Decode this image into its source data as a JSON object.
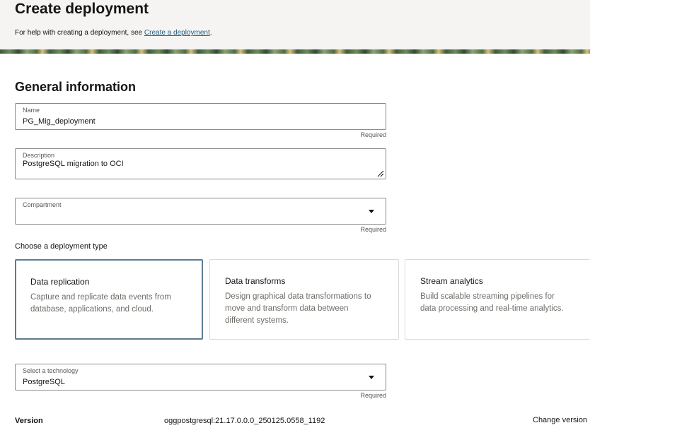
{
  "header": {
    "title": "Create deployment",
    "help_prefix": "For help with creating a deployment, see ",
    "help_link": "Create a deployment",
    "help_suffix": "."
  },
  "general": {
    "title": "General information",
    "name": {
      "label": "Name",
      "value": "PG_Mig_deployment",
      "required": "Required"
    },
    "description": {
      "label": "Description",
      "value": "PostgreSQL migration to OCI"
    },
    "compartment": {
      "label": "Compartment",
      "value": "",
      "required": "Required"
    }
  },
  "deployment_type": {
    "label": "Choose a deployment type",
    "cards": [
      {
        "title": "Data replication",
        "desc_lines": [
          "Capture and replicate data events from",
          "database, applications, and cloud."
        ],
        "selected": true
      },
      {
        "title": "Data transforms",
        "desc_lines": [
          "Design graphical data transformations to",
          "move and transform data between",
          "different systems."
        ],
        "selected": false
      },
      {
        "title": "Stream analytics",
        "desc_lines": [
          "Build scalable streaming pipelines for",
          "data processing and real-time analytics."
        ],
        "selected": false
      }
    ]
  },
  "technology": {
    "label": "Select a technology",
    "value": "PostgreSQL",
    "required": "Required"
  },
  "version": {
    "label": "Version",
    "value": "oggpostgresql:21.17.0.0.0_250125.0558_1192",
    "change_label": "Change version"
  },
  "colors": {
    "accent": "#1f5d84",
    "selected_border": "#5c7d90",
    "header_bg": "#f5f4f2"
  }
}
